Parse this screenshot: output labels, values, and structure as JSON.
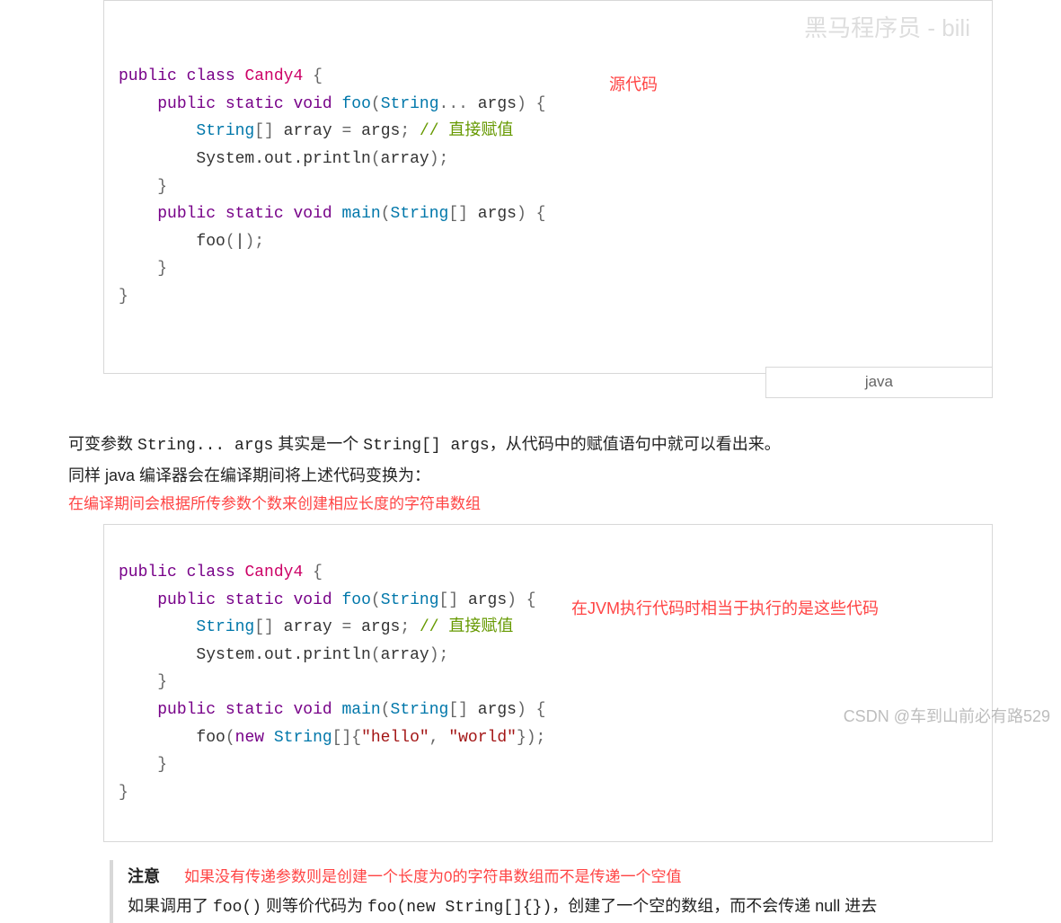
{
  "watermark_top": "黑马程序员 - bili",
  "watermark_bottom": "CSDN @车到山前必有路529",
  "lang_badge": "java",
  "annotation1": "源代码",
  "annotation2": "在JVM执行代码时相当于执行的是这些代码",
  "code1": {
    "kw_public": "public",
    "kw_class": "class",
    "cls_name": "Candy4",
    "kw_static": "static",
    "kw_void": "void",
    "fn_foo": "foo",
    "fn_main": "main",
    "type_string": "String",
    "var_args": "args",
    "var_array": "array",
    "comment": "// 直接赋值",
    "sys_out": "System.out.println",
    "cursor": "|"
  },
  "para1_prefix": "可变参数 ",
  "para1_code1": "String... args",
  "para1_mid": " 其实是一个 ",
  "para1_code2": "String[] args",
  "para1_suffix": "，从代码中的赋值语句中就可以看出来。",
  "para2": "同样 java 编译器会在编译期间将上述代码变换为：",
  "red_para": "在编译期间会根据所传参数个数来创建相应长度的字符串数组",
  "code2": {
    "kw_new": "new",
    "str_hello": "\"hello\"",
    "str_world": "\"world\""
  },
  "note": {
    "title": "注意",
    "red": "如果没有传递参数则是创建一个长度为0的字符串数组而不是传递一个空值",
    "body_prefix": "如果调用了 ",
    "body_code1": "foo()",
    "body_mid": " 则等价代码为 ",
    "body_code2": "foo(new String[]{})",
    "body_suffix": "，创建了一个空的数组，而不会传递 null 进去"
  }
}
